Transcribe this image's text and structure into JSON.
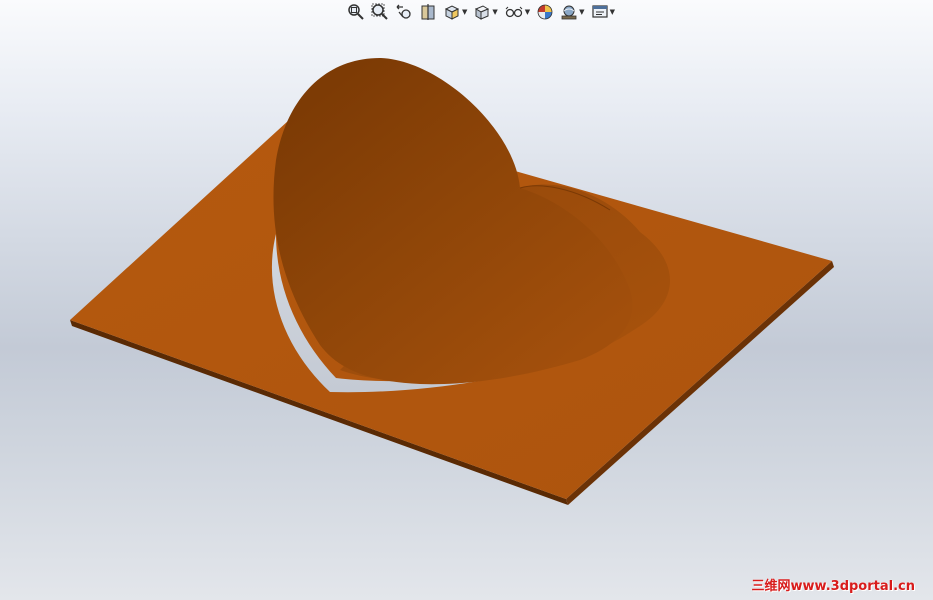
{
  "viewport": {
    "background_top": "#fafbfd",
    "background_bottom": "#e3e6eb"
  },
  "heads_up_toolbar": {
    "tools": [
      {
        "icon": "zoom-to-fit-icon",
        "dropdown": false
      },
      {
        "icon": "zoom-to-area-icon",
        "dropdown": false
      },
      {
        "icon": "previous-view-icon",
        "dropdown": false
      },
      {
        "icon": "section-view-icon",
        "dropdown": false
      },
      {
        "icon": "view-orientation-icon",
        "dropdown": true
      },
      {
        "icon": "display-style-icon",
        "dropdown": true
      },
      {
        "icon": "hide-show-items-icon",
        "dropdown": true
      },
      {
        "icon": "edit-appearance-icon",
        "dropdown": false
      },
      {
        "icon": "apply-scene-icon",
        "dropdown": true
      },
      {
        "icon": "view-settings-icon",
        "dropdown": true
      }
    ]
  },
  "model": {
    "part_color": "#b3580f",
    "heart_color": "#8f4408",
    "edge_color": "#5a2a04"
  },
  "watermark": {
    "text": "三维网www.3dportal.cn",
    "color": "#d81c1c"
  }
}
